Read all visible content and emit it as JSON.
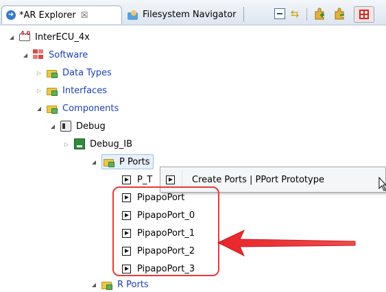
{
  "tabs": {
    "active": {
      "label": "*AR Explorer",
      "close_glyph": "☒"
    },
    "inactive": {
      "label": "Filesystem Navigator"
    }
  },
  "ecu": {
    "icon_text": "4.0",
    "label": "InterECU_4x"
  },
  "tree": {
    "software": "Software",
    "data_types": "Data Types",
    "interfaces": "Interfaces",
    "components": "Components",
    "debug": "Debug",
    "debug_ib": "Debug_IB",
    "p_ports": "P Ports",
    "p_truncated": "P_T",
    "ports": [
      "PipapoPort",
      "PipapoPort_0",
      "PipapoPort_1",
      "PipapoPort_2",
      "PipapoPort_3"
    ],
    "r_ports": "R Ports"
  },
  "context_menu": {
    "item": "Create Ports | PPort Prototype"
  },
  "colors": {
    "highlight": "#e8373a",
    "tree_blue": "#1a3fb8",
    "menu_bg": "#f5f6f7"
  }
}
